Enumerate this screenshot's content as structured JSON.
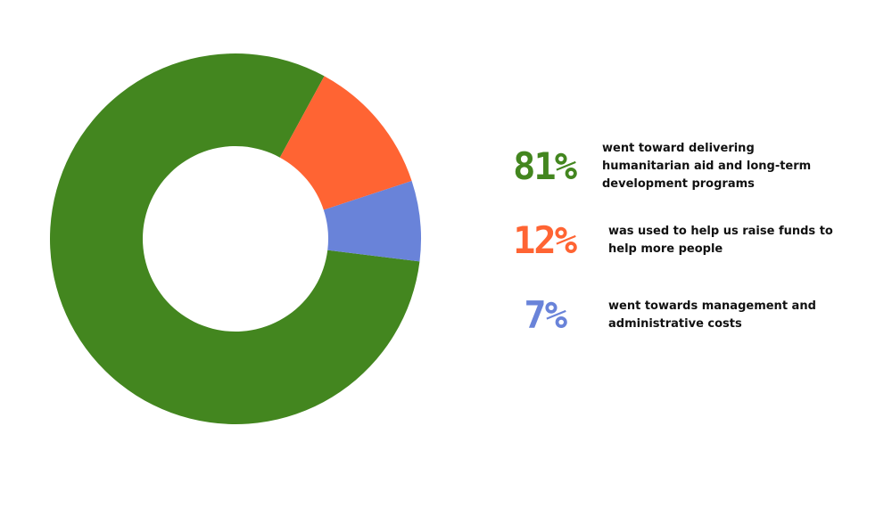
{
  "chart_data": {
    "type": "pie",
    "style": "donut",
    "categories": [
      "went toward delivering humanitarian aid and long-term development programs",
      "was used to help us raise funds to help more people",
      "went towards management and administrative costs"
    ],
    "values": [
      81,
      12,
      7
    ],
    "labels": [
      "81%",
      "12%",
      "7%"
    ],
    "colors": [
      "#43861f",
      "#ff6433",
      "#6983d9"
    ],
    "legend": "right",
    "grid": false
  }
}
